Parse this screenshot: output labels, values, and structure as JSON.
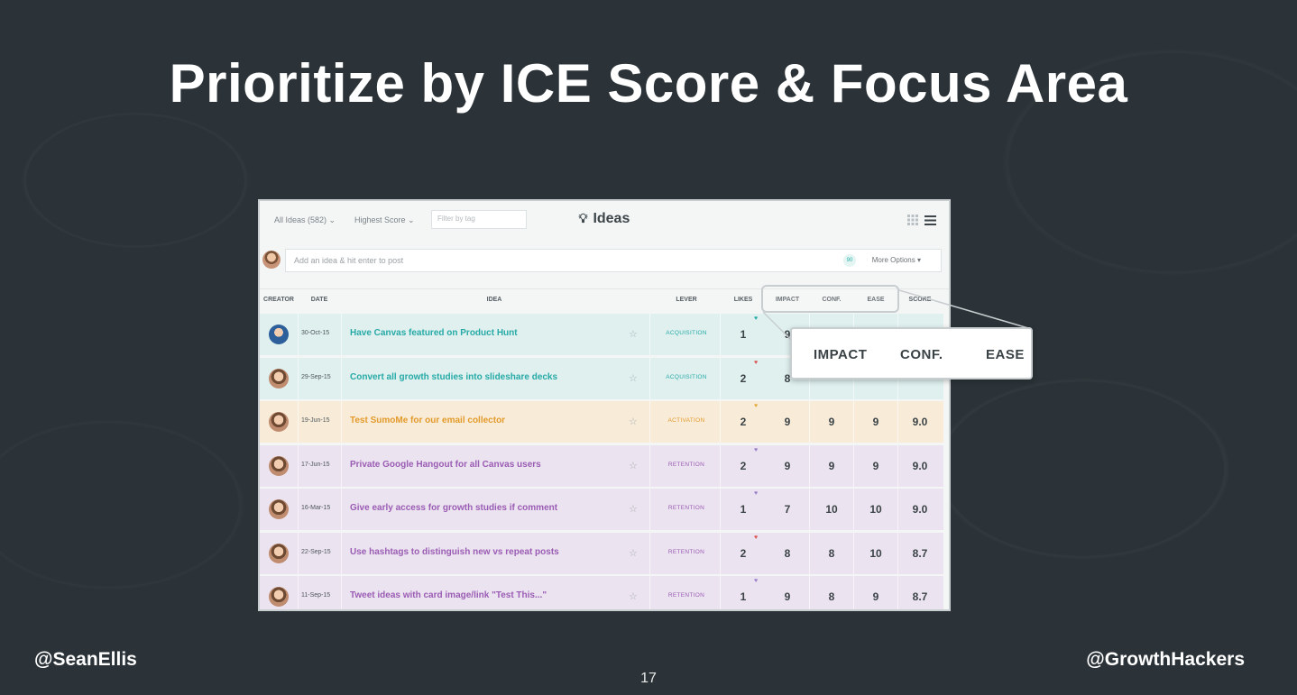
{
  "slide": {
    "title": "Prioritize by ICE Score & Focus Area",
    "handle_left": "@SeanEllis",
    "handle_right": "@GrowthHackers",
    "page_number": "17"
  },
  "toolbar": {
    "filter_ideas": "All Ideas (582) ⌄",
    "sort": "Highest Score ⌄",
    "tag_placeholder": "Filter by tag",
    "title": "Ideas",
    "icons": [
      "bulb-icon",
      "grid-view-icon",
      "list-view-icon"
    ]
  },
  "post": {
    "placeholder": "Add an idea & hit enter to post",
    "badge": "90",
    "more_options": "More Options ▾"
  },
  "columns": {
    "creator": "CREATOR",
    "date": "DATE",
    "idea": "IDEA",
    "lever": "LEVER",
    "likes": "LIKES",
    "impact": "IMPACT",
    "conf": "CONF.",
    "ease": "EASE",
    "score": "SCORE"
  },
  "colors": {
    "acquisition_bg": "#dff0ef",
    "acquisition_text": "#27aaa6",
    "activation_bg": "#f8ecd9",
    "activation_text": "#e39a2a",
    "retention_bg": "#ebe3ef",
    "retention_text": "#9a5cb4"
  },
  "rows": [
    {
      "date": "30-Oct-15",
      "idea": "Have Canvas featured on Product Hunt",
      "lever": "ACQUISITION",
      "likes": "1",
      "impact": "9",
      "conf": "",
      "ease": "",
      "score": "",
      "type": "acquisition",
      "heart": "♥",
      "avatar": "blue"
    },
    {
      "date": "29-Sep-15",
      "idea": "Convert all growth studies into slideshare decks",
      "lever": "ACQUISITION",
      "likes": "2",
      "impact": "8",
      "conf": "",
      "ease": "",
      "score": "",
      "type": "acquisition",
      "heart": "♥",
      "avatar": "brown"
    },
    {
      "date": "19-Jun-15",
      "idea": "Test SumoMe for our email collector",
      "lever": "ACTIVATION",
      "likes": "2",
      "impact": "9",
      "conf": "9",
      "ease": "9",
      "score": "9.0",
      "type": "activation",
      "heart": "♥",
      "avatar": "brown"
    },
    {
      "date": "17-Jun-15",
      "idea": "Private Google Hangout for all Canvas users",
      "lever": "RETENTION",
      "likes": "2",
      "impact": "9",
      "conf": "9",
      "ease": "9",
      "score": "9.0",
      "type": "retention",
      "heart": "♥",
      "avatar": "brown"
    },
    {
      "date": "16-Mar-15",
      "idea": "Give early access for growth studies if comment",
      "lever": "RETENTION",
      "likes": "1",
      "impact": "7",
      "conf": "10",
      "ease": "10",
      "score": "9.0",
      "type": "retention",
      "heart": "♥",
      "avatar": "brown"
    },
    {
      "date": "22-Sep-15",
      "idea": "Use hashtags to distinguish new vs repeat posts",
      "lever": "RETENTION",
      "likes": "2",
      "impact": "8",
      "conf": "8",
      "ease": "10",
      "score": "8.7",
      "type": "retention",
      "heart": "♥",
      "avatar": "brown"
    },
    {
      "date": "11-Sep-15",
      "idea": "Tweet ideas with card image/link \"Test This...\"",
      "lever": "RETENTION",
      "likes": "1",
      "impact": "9",
      "conf": "8",
      "ease": "9",
      "score": "8.7",
      "type": "retention",
      "heart": "♥",
      "avatar": "brown"
    }
  ],
  "callout": {
    "impact": "IMPACT",
    "conf": "CONF.",
    "ease": "EASE"
  }
}
